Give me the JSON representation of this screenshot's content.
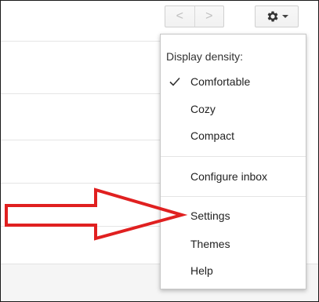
{
  "nav": {
    "prev_glyph": "<",
    "next_glyph": ">"
  },
  "settings_button": {
    "icon": "gear-icon",
    "caret": "chevron-down-icon"
  },
  "menu": {
    "header": "Display density:",
    "density_options": [
      {
        "label": "Comfortable",
        "checked": true
      },
      {
        "label": "Cozy",
        "checked": false
      },
      {
        "label": "Compact",
        "checked": false
      }
    ],
    "configure_inbox": "Configure inbox",
    "settings": "Settings",
    "themes": "Themes",
    "help": "Help"
  },
  "colors": {
    "arrow": "#e02020",
    "menu_border": "#c6c6c6"
  }
}
